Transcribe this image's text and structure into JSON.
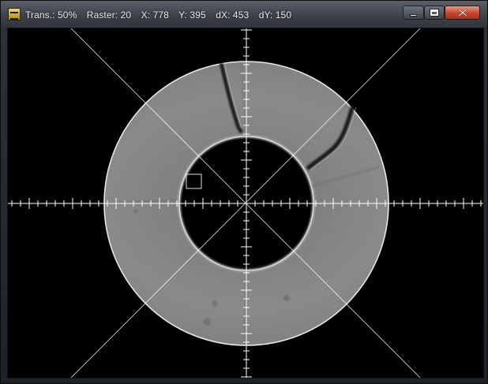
{
  "window": {
    "status": {
      "trans": "Trans.: 50%",
      "raster": "Raster: 20",
      "x": "X: 778",
      "y": "Y: 395",
      "dx": "dX: 453",
      "dy": "dY: 150"
    },
    "controls": {
      "minimize": "minimize",
      "maximize": "maximize",
      "close": "close"
    }
  },
  "icons": {
    "app": "camera-app-icon",
    "minimize": "minimize-icon",
    "maximize": "maximize-icon",
    "close": "close-icon"
  },
  "colors": {
    "window_frame": "#3c4148",
    "close_button": "#c7452d",
    "crosshair": "#ffffff",
    "ring": "#8c8c8c",
    "background": "#000000"
  }
}
